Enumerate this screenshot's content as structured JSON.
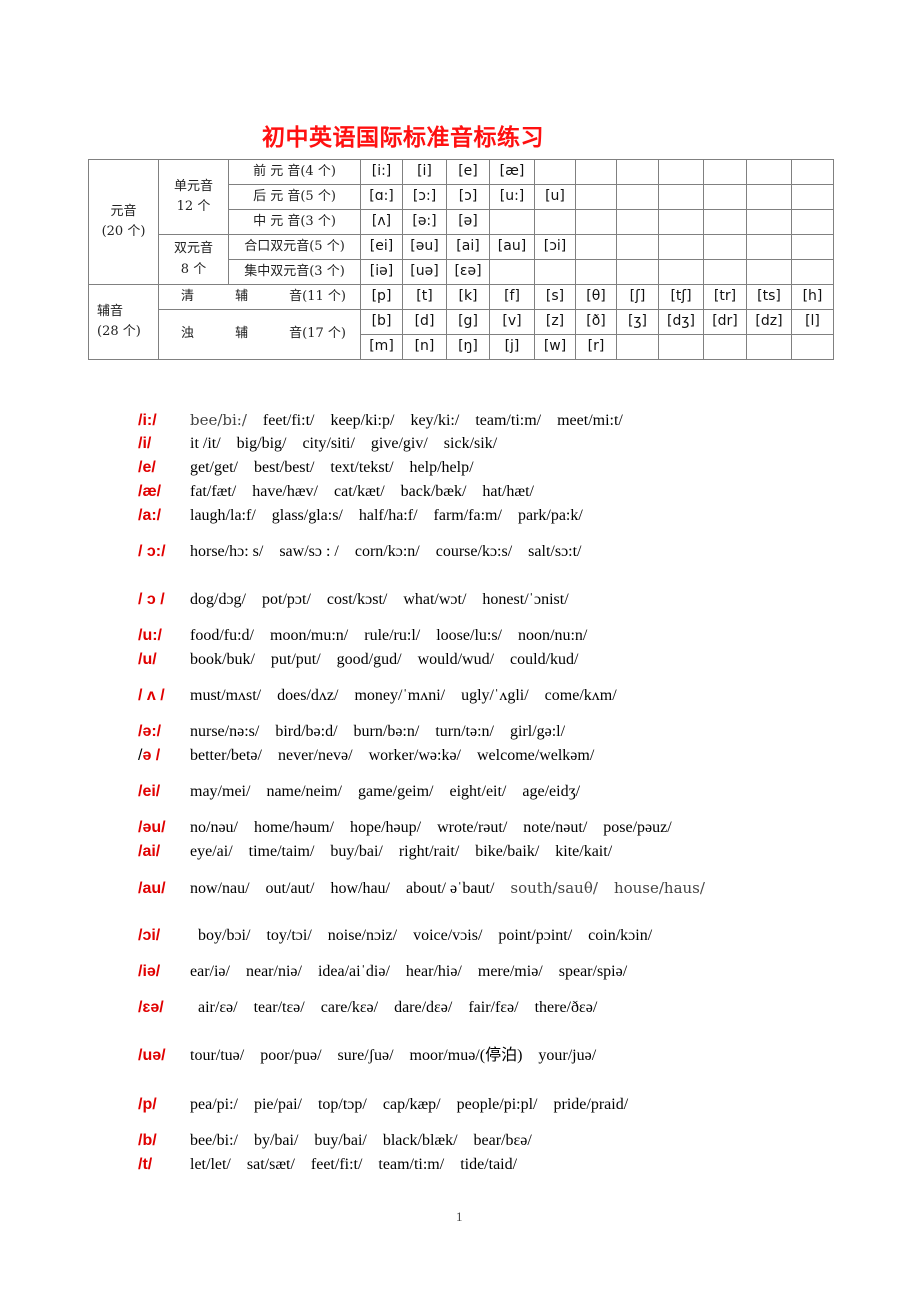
{
  "title": "初中英语国际标准音标练习",
  "table": {
    "vowel_group": "元音",
    "vowel_count": "(20 个)",
    "consonant_group": "辅音",
    "consonant_count": "(28 个)",
    "monophthong_label": "单元音",
    "monophthong_count": "12 个",
    "diphthong_label": "双元音",
    "diphthong_count": "8 个",
    "rows": [
      {
        "category": "前 元 音(4 个)",
        "symbols": [
          "[i:]",
          "[i]",
          "[e]",
          "[æ]",
          "",
          "",
          "",
          "",
          "",
          "",
          ""
        ]
      },
      {
        "category": "后 元 音(5 个)",
        "symbols": [
          "[ɑ:]",
          "[ɔ:]",
          "[ɔ]",
          "[u:]",
          "[u]",
          "",
          "",
          "",
          "",
          "",
          ""
        ]
      },
      {
        "category": "中 元 音(3 个)",
        "symbols": [
          "[ʌ]",
          "[ə:]",
          "[ə]",
          "",
          "",
          "",
          "",
          "",
          "",
          "",
          ""
        ]
      },
      {
        "category": "合口双元音(5 个)",
        "symbols": [
          "[ei]",
          "[əu]",
          "[ai]",
          "[au]",
          "[ɔi]",
          "",
          "",
          "",
          "",
          "",
          ""
        ]
      },
      {
        "category": "集中双元音(3 个)",
        "symbols": [
          "[iə]",
          "[uə]",
          "[ɛə]",
          "",
          "",
          "",
          "",
          "",
          "",
          "",
          ""
        ]
      },
      {
        "category_parts": [
          "清",
          "辅",
          "音(11 个)"
        ],
        "symbols": [
          "[p]",
          "[t]",
          "[k]",
          "[f]",
          "[s]",
          "[θ]",
          "[ʃ]",
          "[tʃ]",
          "[tr]",
          "[ts]",
          "[h]"
        ]
      },
      {
        "category_parts": [
          "浊",
          "辅",
          "音(17 个)"
        ],
        "symbols": [
          "[b]",
          "[d]",
          "[g]",
          "[v]",
          "[z]",
          "[ð]",
          "[ʒ]",
          "[dʒ]",
          "[dr]",
          "[dz]",
          "[l]"
        ]
      },
      {
        "symbols": [
          "[m]",
          "[n]",
          "[ŋ]",
          "[j]",
          "[w]",
          "[r]",
          "",
          "",
          "",
          "",
          ""
        ]
      }
    ]
  },
  "lines": [
    {
      "label": "/i:/",
      "words": [
        {
          "t": "bee/bi:/",
          "alt": true
        },
        {
          "t": "feet/fi:t/"
        },
        {
          "t": "keep/ki:p/"
        },
        {
          "t": "key/ki:/"
        },
        {
          "t": "team/ti:m/"
        },
        {
          "t": "meet/mi:t/"
        }
      ]
    },
    {
      "label": "/i/",
      "words": [
        {
          "t": "it /it/"
        },
        {
          "t": "big/big/"
        },
        {
          "t": "city/siti/"
        },
        {
          "t": "give/giv/"
        },
        {
          "t": "sick/sik/"
        }
      ]
    },
    {
      "label": "/e/",
      "words": [
        {
          "t": "get/get/"
        },
        {
          "t": "best/best/"
        },
        {
          "t": "text/tekst/"
        },
        {
          "t": "help/help/"
        }
      ]
    },
    {
      "label": "/æ/",
      "words": [
        {
          "t": "fat/fæt/"
        },
        {
          "t": "have/hæv/"
        },
        {
          "t": "cat/kæt/"
        },
        {
          "t": "back/bæk/"
        },
        {
          "t": "hat/hæt/"
        }
      ]
    },
    {
      "label": "/a:/",
      "words": [
        {
          "t": "laugh/la:f/"
        },
        {
          "t": "glass/gla:s/"
        },
        {
          "t": "half/ha:f/"
        },
        {
          "t": "farm/fa:m/"
        },
        {
          "t": "park/pa:k/"
        }
      ]
    },
    {
      "label": "/ ɔ:/",
      "words": [
        {
          "t": "horse/hɔ: s/"
        },
        {
          "t": "saw/sɔ : /"
        },
        {
          "t": "corn/kɔ:n/"
        },
        {
          "t": "course/kɔ:s/"
        },
        {
          "t": "salt/sɔ:t/"
        }
      ]
    },
    {
      "label": "/ ɔ /",
      "words": [
        {
          "t": "dog/dɔg/"
        },
        {
          "t": "pot/pɔt/"
        },
        {
          "t": "cost/kɔst/"
        },
        {
          "t": "what/wɔt/"
        },
        {
          "t": "honest/ˈɔnist/"
        }
      ]
    },
    {
      "label": "/u:/",
      "words": [
        {
          "t": "food/fu:d/"
        },
        {
          "t": "moon/mu:n/"
        },
        {
          "t": "rule/ru:l/"
        },
        {
          "t": "loose/lu:s/"
        },
        {
          "t": "noon/nu:n/"
        }
      ]
    },
    {
      "label": "/u/",
      "words": [
        {
          "t": "book/buk/"
        },
        {
          "t": "put/put/"
        },
        {
          "t": "good/gud/"
        },
        {
          "t": "would/wud/"
        },
        {
          "t": "could/kud/"
        }
      ]
    },
    {
      "label": "/ ʌ /",
      "words": [
        {
          "t": "must/mʌst/"
        },
        {
          "t": "does/dʌz/"
        },
        {
          "t": "money/ˈmʌni/"
        },
        {
          "t": "ugly/ˈʌgli/"
        },
        {
          "t": "come/kʌm/"
        }
      ]
    },
    {
      "label": "/ə:/",
      "words": [
        {
          "t": "nurse/nə:s/"
        },
        {
          "t": "bird/bə:d/"
        },
        {
          "t": "burn/bə:n/"
        },
        {
          "t": "turn/tə:n/"
        },
        {
          "t": "girl/gə:l/"
        }
      ]
    },
    {
      "label_prefix": "/",
      "label": "ə /",
      "words": [
        {
          "t": "better/betə/"
        },
        {
          "t": "never/nevə/"
        },
        {
          "t": "worker/wə:kə/"
        },
        {
          "t": "welcome/welkəm/"
        }
      ]
    },
    {
      "label": "/ei/",
      "words": [
        {
          "t": "may/mei/"
        },
        {
          "t": "name/neim/"
        },
        {
          "t": "game/geim/"
        },
        {
          "t": "eight/eit/"
        },
        {
          "t": "age/eidʒ/"
        }
      ]
    },
    {
      "label": "/əu/",
      "words": [
        {
          "t": "no/nəu/"
        },
        {
          "t": "home/həum/"
        },
        {
          "t": "hope/həup/"
        },
        {
          "t": "wrote/rəut/"
        },
        {
          "t": "note/nəut/"
        },
        {
          "t": "pose/pəuz/"
        }
      ]
    },
    {
      "label": "/ai/",
      "words": [
        {
          "t": "eye/ai/"
        },
        {
          "t": "time/taim/"
        },
        {
          "t": "buy/bai/"
        },
        {
          "t": "right/rait/"
        },
        {
          "t": "bike/baik/"
        },
        {
          "t": "kite/kait/"
        }
      ]
    },
    {
      "label": "/au/",
      "words": [
        {
          "t": "now/nau/"
        },
        {
          "t": "out/aut/"
        },
        {
          "t": "how/hau/"
        },
        {
          "t": "about/ əˈbaut/"
        },
        {
          "t": "south/sauθ/",
          "alt": true
        },
        {
          "t": "house/haus/",
          "alt": true
        }
      ]
    },
    {
      "label": "/ɔi/",
      "words": [
        {
          "t": "boy/bɔi/"
        },
        {
          "t": "toy/tɔi/"
        },
        {
          "t": "noise/nɔiz/"
        },
        {
          "t": "voice/vɔis/"
        },
        {
          "t": "point/pɔint/"
        },
        {
          "t": "coin/kɔin/"
        }
      ]
    },
    {
      "label": "/iə/",
      "words": [
        {
          "t": "ear/iə/"
        },
        {
          "t": "near/niə/"
        },
        {
          "t": "idea/aiˈdiə/"
        },
        {
          "t": "hear/hiə/"
        },
        {
          "t": "mere/miə/"
        },
        {
          "t": "spear/spiə/"
        }
      ]
    },
    {
      "label": "/ɛə/",
      "words": [
        {
          "t": "air/ɛə/"
        },
        {
          "t": "tear/tɛə/"
        },
        {
          "t": "care/kɛə/"
        },
        {
          "t": "dare/dɛə/"
        },
        {
          "t": "fair/fɛə/"
        },
        {
          "t": "there/ðɛə/"
        }
      ]
    },
    {
      "label": "/uə/",
      "words": [
        {
          "t": "tour/tuə/"
        },
        {
          "t": "poor/puə/"
        },
        {
          "t": "sure/ʃuə/"
        },
        {
          "t": "moor/muə/(停泊)"
        },
        {
          "t": "your/juə/"
        }
      ]
    },
    {
      "label": "/p/",
      "words": [
        {
          "t": "pea/pi:/"
        },
        {
          "t": "pie/pai/"
        },
        {
          "t": "top/tɔp/"
        },
        {
          "t": "cap/kæp/"
        },
        {
          "t": "people/pi:pl/"
        },
        {
          "t": "pride/praid/"
        }
      ]
    },
    {
      "label": "/b/",
      "words": [
        {
          "t": "bee/bi:/"
        },
        {
          "t": "by/bai/"
        },
        {
          "t": "buy/bai/"
        },
        {
          "t": "black/blæk/"
        },
        {
          "t": "bear/bɛə/"
        }
      ]
    },
    {
      "label": "/t/",
      "words": [
        {
          "t": "let/let/"
        },
        {
          "t": "sat/sæt/"
        },
        {
          "t": "feet/fi:t/"
        },
        {
          "t": "team/ti:m/"
        },
        {
          "t": "tide/taid/"
        }
      ]
    }
  ],
  "page_number": "1"
}
